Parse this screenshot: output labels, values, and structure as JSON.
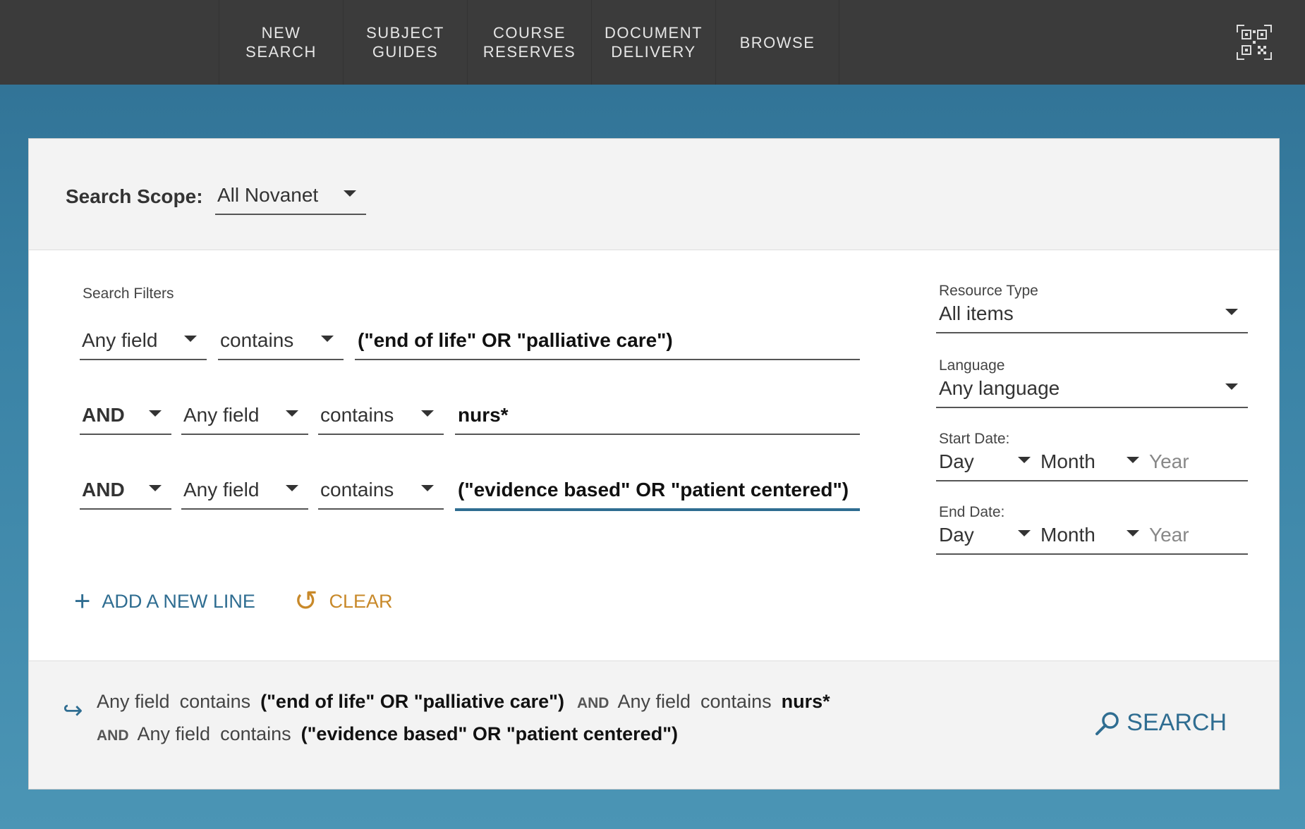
{
  "nav": {
    "items": [
      {
        "line1": "NEW",
        "line2": "SEARCH"
      },
      {
        "line1": "SUBJECT",
        "line2": "GUIDES"
      },
      {
        "line1": "COURSE",
        "line2": "RESERVES"
      },
      {
        "line1": "DOCUMENT",
        "line2": "DELIVERY"
      },
      {
        "line1": "BROWSE",
        "line2": ""
      }
    ]
  },
  "scope": {
    "label": "Search Scope:",
    "value": "All Novanet"
  },
  "filters": {
    "label": "Search Filters",
    "rows": [
      {
        "operator": "",
        "field": "Any field",
        "condition": "contains",
        "term": "(\"end of life\" OR \"palliative care\")"
      },
      {
        "operator": "AND",
        "field": "Any field",
        "condition": "contains",
        "term": "nurs*"
      },
      {
        "operator": "AND",
        "field": "Any field",
        "condition": "contains",
        "term": "(\"evidence based\" OR \"patient centered\")"
      }
    ],
    "add_line": "ADD A NEW LINE",
    "clear": "CLEAR"
  },
  "right": {
    "resource_type": {
      "label": "Resource Type",
      "value": "All items"
    },
    "language": {
      "label": "Language",
      "value": "Any language"
    },
    "start_date": {
      "label": "Start Date:",
      "day": "Day",
      "month": "Month",
      "year": "Year"
    },
    "end_date": {
      "label": "End Date:",
      "day": "Day",
      "month": "Month",
      "year": "Year"
    }
  },
  "summary": {
    "line1": {
      "f1": "Any field",
      "c1": "contains",
      "v1": "(\"end of life\" OR \"palliative care\")",
      "op": "AND",
      "f2": "Any field",
      "c2": "contains",
      "v2": "nurs*"
    },
    "line2": {
      "op": "AND",
      "f": "Any field",
      "c": "contains",
      "v": "(\"evidence based\" OR \"patient centered\")"
    },
    "search_label": "SEARCH"
  },
  "colors": {
    "accent": "#2f6d91",
    "clear": "#c8892a",
    "topbar": "#3b3b3b"
  }
}
